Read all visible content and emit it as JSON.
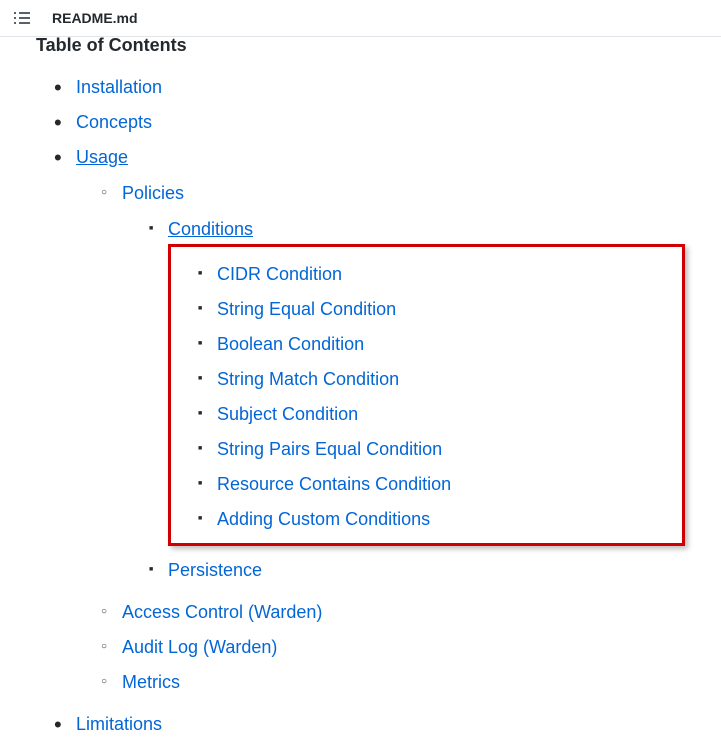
{
  "header": {
    "filename": "README.md"
  },
  "toc": {
    "title": "Table of Contents",
    "items": [
      {
        "label": "Installation"
      },
      {
        "label": "Concepts"
      },
      {
        "label": "Usage",
        "underline": true,
        "children": [
          {
            "label": "Policies",
            "children": [
              {
                "label": "Conditions",
                "underline": true,
                "highlight_children": true,
                "children": [
                  {
                    "label": "CIDR Condition"
                  },
                  {
                    "label": "String Equal Condition"
                  },
                  {
                    "label": "Boolean Condition"
                  },
                  {
                    "label": "String Match Condition"
                  },
                  {
                    "label": "Subject Condition"
                  },
                  {
                    "label": "String Pairs Equal Condition"
                  },
                  {
                    "label": "Resource Contains Condition"
                  },
                  {
                    "label": "Adding Custom Conditions"
                  }
                ]
              },
              {
                "label": "Persistence"
              }
            ]
          },
          {
            "label": "Access Control (Warden)"
          },
          {
            "label": "Audit Log (Warden)"
          },
          {
            "label": "Metrics"
          }
        ]
      },
      {
        "label": "Limitations"
      }
    ]
  }
}
